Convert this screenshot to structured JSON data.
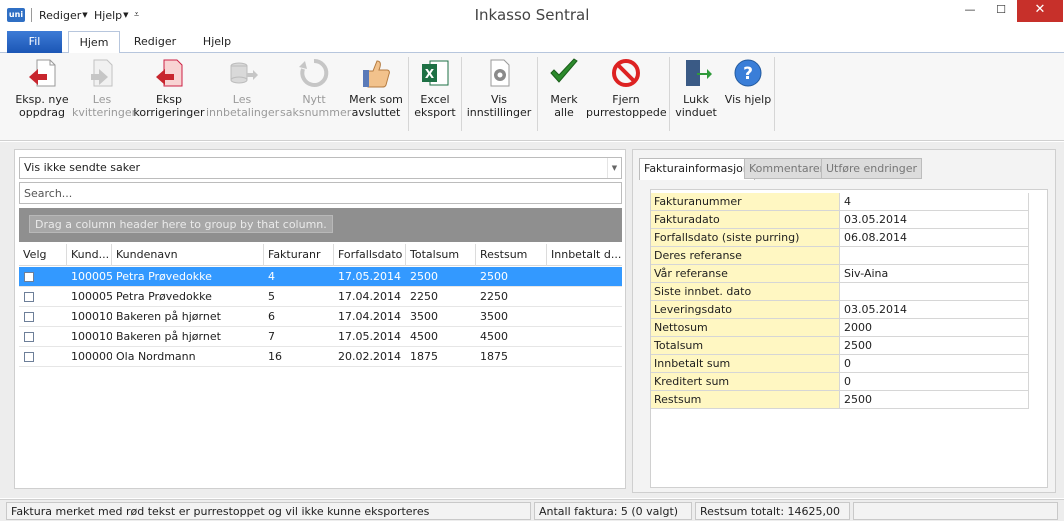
{
  "window": {
    "title": "Inkasso Sentral",
    "logo": "uni",
    "quick_access": [
      "Rediger",
      "Hjelp"
    ],
    "minimize": "—",
    "maximize": "☐",
    "close": "✕"
  },
  "tabs": {
    "file": "Fil",
    "items": [
      "Hjem",
      "Rediger",
      "Hjelp"
    ],
    "active": "Hjem"
  },
  "ribbon": {
    "buttons": [
      {
        "label": "Eksp. nye oppdrag",
        "icon": "export-red-arrow-icon",
        "enabled": true
      },
      {
        "label": "Les kvitteringer",
        "icon": "import-receipts-icon",
        "enabled": false
      },
      {
        "label": "Eksp korrigeringer",
        "icon": "export-corrections-icon",
        "enabled": true
      },
      {
        "label": "Les innbetalinger",
        "icon": "read-payments-icon",
        "enabled": false
      },
      {
        "label": "Nytt saksnummer",
        "icon": "new-case-number-icon",
        "enabled": false
      },
      {
        "label": "Merk som avsluttet",
        "icon": "thumbs-up-icon",
        "enabled": true
      },
      {
        "label": "Excel eksport",
        "icon": "excel-icon",
        "enabled": true
      },
      {
        "label": "Vis innstillinger",
        "icon": "settings-icon",
        "enabled": true
      },
      {
        "label": "Merk alle",
        "icon": "checkmark-icon",
        "enabled": true
      },
      {
        "label": "Fjern purrestoppede",
        "icon": "prohibited-icon",
        "enabled": true
      },
      {
        "label": "Lukk vinduet",
        "icon": "exit-door-icon",
        "enabled": true
      },
      {
        "label": "Vis hjelp",
        "icon": "help-icon",
        "enabled": true
      }
    ]
  },
  "filter": {
    "selected": "Vis ikke sendte saker"
  },
  "search": {
    "placeholder": "Search..."
  },
  "grid": {
    "group_hint": "Drag a column header here to group by that column.",
    "columns": [
      "Velg",
      "Kund...",
      "Kundenavn",
      "Fakturanr",
      "Forfallsdato",
      "Totalsum",
      "Restsum",
      "Innbetalt d..."
    ],
    "rows": [
      {
        "kundenr": "100005",
        "kundenavn": "Petra Prøvedokke",
        "fakturanr": "4",
        "forfallsdato": "17.05.2014",
        "totalsum": "2500",
        "restsum": "2500",
        "innbetalt": "",
        "selected": true
      },
      {
        "kundenr": "100005",
        "kundenavn": "Petra Prøvedokke",
        "fakturanr": "5",
        "forfallsdato": "17.04.2014",
        "totalsum": "2250",
        "restsum": "2250",
        "innbetalt": "",
        "selected": false
      },
      {
        "kundenr": "100010",
        "kundenavn": "Bakeren på hjørnet",
        "fakturanr": "6",
        "forfallsdato": "17.04.2014",
        "totalsum": "3500",
        "restsum": "3500",
        "innbetalt": "",
        "selected": false
      },
      {
        "kundenr": "100010",
        "kundenavn": "Bakeren på hjørnet",
        "fakturanr": "7",
        "forfallsdato": "17.05.2014",
        "totalsum": "4500",
        "restsum": "4500",
        "innbetalt": "",
        "selected": false
      },
      {
        "kundenr": "100000",
        "kundenavn": "Ola Nordmann",
        "fakturanr": "16",
        "forfallsdato": "20.02.2014",
        "totalsum": "1875",
        "restsum": "1875",
        "innbetalt": "",
        "selected": false
      }
    ]
  },
  "details": {
    "tabs": [
      "Fakturainformasjon",
      "Kommentarer",
      "Utføre endringer"
    ],
    "active_tab": "Fakturainformasjon",
    "fields": [
      {
        "key": "Fakturanummer",
        "value": "4"
      },
      {
        "key": "Fakturadato",
        "value": "03.05.2014"
      },
      {
        "key": "Forfallsdato (siste purring)",
        "value": "06.08.2014"
      },
      {
        "key": "Deres referanse",
        "value": ""
      },
      {
        "key": "Vår referanse",
        "value": "Siv-Aina"
      },
      {
        "key": "Siste innbet. dato",
        "value": ""
      },
      {
        "key": "Leveringsdato",
        "value": "03.05.2014"
      },
      {
        "key": "Nettosum",
        "value": "2000"
      },
      {
        "key": "Totalsum",
        "value": "2500"
      },
      {
        "key": "Innbetalt sum",
        "value": "0"
      },
      {
        "key": "Kreditert sum",
        "value": "0"
      },
      {
        "key": "Restsum",
        "value": "2500"
      }
    ]
  },
  "status": {
    "message": "Faktura merket med rød tekst er purrestoppet og vil ikke kunne eksporteres",
    "count": "Antall faktura: 5 (0 valgt)",
    "total": "Restsum totalt: 14625,00"
  },
  "colors": {
    "selection": "#3399ff",
    "file_tab": "#1b56b5",
    "info_key_bg": "#fff7c2",
    "close_button": "#c7302a"
  }
}
